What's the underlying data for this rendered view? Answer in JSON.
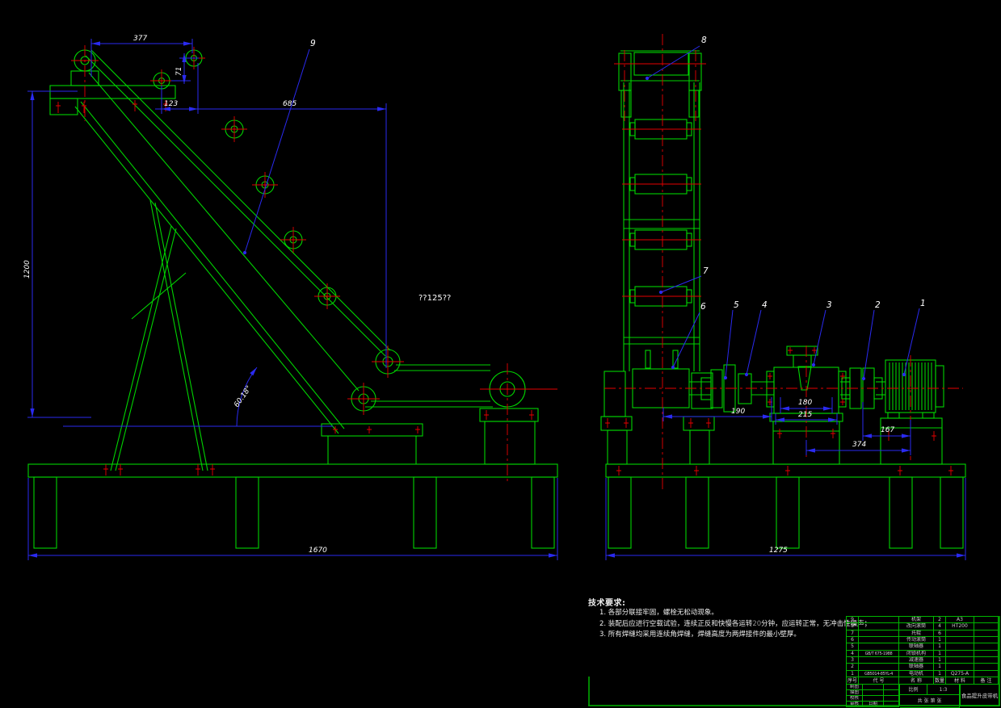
{
  "left_view": {
    "callout_9": "9",
    "dim_377": "377",
    "dim_71": "71",
    "dim_123": "123",
    "dim_685": "685",
    "dim_1200": "1200",
    "dim_1670": "1670",
    "angle": "60.18°",
    "belt_label": "??125??"
  },
  "right_view": {
    "dim_190": "190",
    "dim_180": "180",
    "dim_215": "215",
    "dim_167": "167",
    "dim_374": "374",
    "dim_1275": "1275",
    "callout_1": "1",
    "callout_2": "2",
    "callout_3": "3",
    "callout_4": "4",
    "callout_5": "5",
    "callout_6": "6",
    "callout_7": "7",
    "callout_8": "8"
  },
  "tech_requirements": {
    "title": "技术要求:",
    "line1": "1. 各部分联接牢固，螺栓无松动现象。",
    "line2_pre": "2. 装配后应进行空载试验，连续正反和快慢各运转",
    "line2_num": "20",
    "line2_post": "分钟，应运转正常，无冲击性噪声；",
    "line3": "3. 所有焊缝均采用连续角焊缝，焊缝高度为两焊接件的最小壁厚。"
  },
  "parts_list": {
    "headers": {
      "no": "序号",
      "code": "代  号",
      "name": "名  称",
      "qty": "数量",
      "material": "材 料",
      "remark": "备 注"
    },
    "rows": [
      {
        "no": "9",
        "code": "",
        "name": "机架",
        "qty": "2",
        "material": "A3",
        "remark": ""
      },
      {
        "no": "8",
        "code": "",
        "name": "改向滚筒",
        "qty": "4",
        "material": "HT200",
        "remark": ""
      },
      {
        "no": "7",
        "code": "",
        "name": "托辊",
        "qty": "6",
        "material": "",
        "remark": ""
      },
      {
        "no": "6",
        "code": "",
        "name": "传动滚筒",
        "qty": "1",
        "material": "",
        "remark": ""
      },
      {
        "no": "5",
        "code": "",
        "name": "联轴器",
        "qty": "1",
        "material": "",
        "remark": ""
      },
      {
        "no": "4",
        "code": "GB/T 675-1988",
        "name": "闭锁机构",
        "qty": "1",
        "material": "",
        "remark": ""
      },
      {
        "no": "3",
        "code": "",
        "name": "减速器",
        "qty": "1",
        "material": "",
        "remark": ""
      },
      {
        "no": "2",
        "code": "",
        "name": "联轴器",
        "qty": "1",
        "material": "",
        "remark": ""
      },
      {
        "no": "1",
        "code": "GB5014-85YL-4",
        "name": "电动机",
        "qty": "1",
        "material": "Q275-A",
        "remark": ""
      }
    ]
  },
  "title_block": {
    "sign_rows": [
      "制图",
      "描图",
      "校核",
      "审核"
    ],
    "date_label": "日期",
    "scale_label": "比例",
    "scale_value": "1:3",
    "sheet_note": "共  张  第  张",
    "drawing_title": "食品提升皮带机"
  },
  "colors": {
    "geometry_green": "#00d400",
    "dimension_blue": "#2a2af0",
    "centerline_red": "#e60000",
    "text_white": "#ffffff",
    "background": "#000000"
  }
}
